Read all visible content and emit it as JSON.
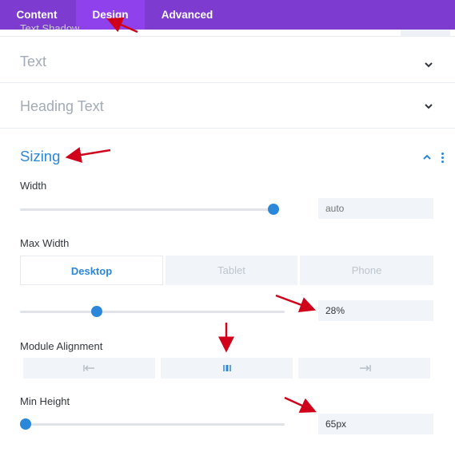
{
  "tabs": [
    {
      "label": "Content",
      "active": false
    },
    {
      "label": "Design",
      "active": true
    },
    {
      "label": "Advanced",
      "active": false
    }
  ],
  "clipped_label": "Text Shadow",
  "collapsed_sections": [
    {
      "title": "Text",
      "icon": "chevron-down-icon"
    },
    {
      "title": "Heading Text",
      "icon": "chevron-down-icon"
    }
  ],
  "sizing": {
    "title": "Sizing",
    "collapse_icon": "chevron-up-icon",
    "menu_icon": "kebab-menu-icon",
    "width": {
      "label": "Width",
      "slider_value": 1.0,
      "placeholder": "auto"
    },
    "max_width": {
      "label": "Max Width",
      "devices": [
        {
          "label": "Desktop",
          "active": true
        },
        {
          "label": "Tablet",
          "active": false
        },
        {
          "label": "Phone",
          "active": false
        }
      ],
      "slider_value": 0.28,
      "value": "28%"
    },
    "module_alignment": {
      "label": "Module Alignment",
      "options": [
        {
          "name": "align-left-icon",
          "selected": false
        },
        {
          "name": "align-center-icon",
          "selected": true
        },
        {
          "name": "align-right-icon",
          "selected": false
        }
      ]
    },
    "min_height": {
      "label": "Min Height",
      "slider_value": 0.0,
      "value": "65px"
    }
  },
  "colors": {
    "tabbar": "#7e3bd0",
    "tab_active": "#8f42ec",
    "accent": "#2b87da",
    "annotation_arrow": "#d0021b"
  }
}
